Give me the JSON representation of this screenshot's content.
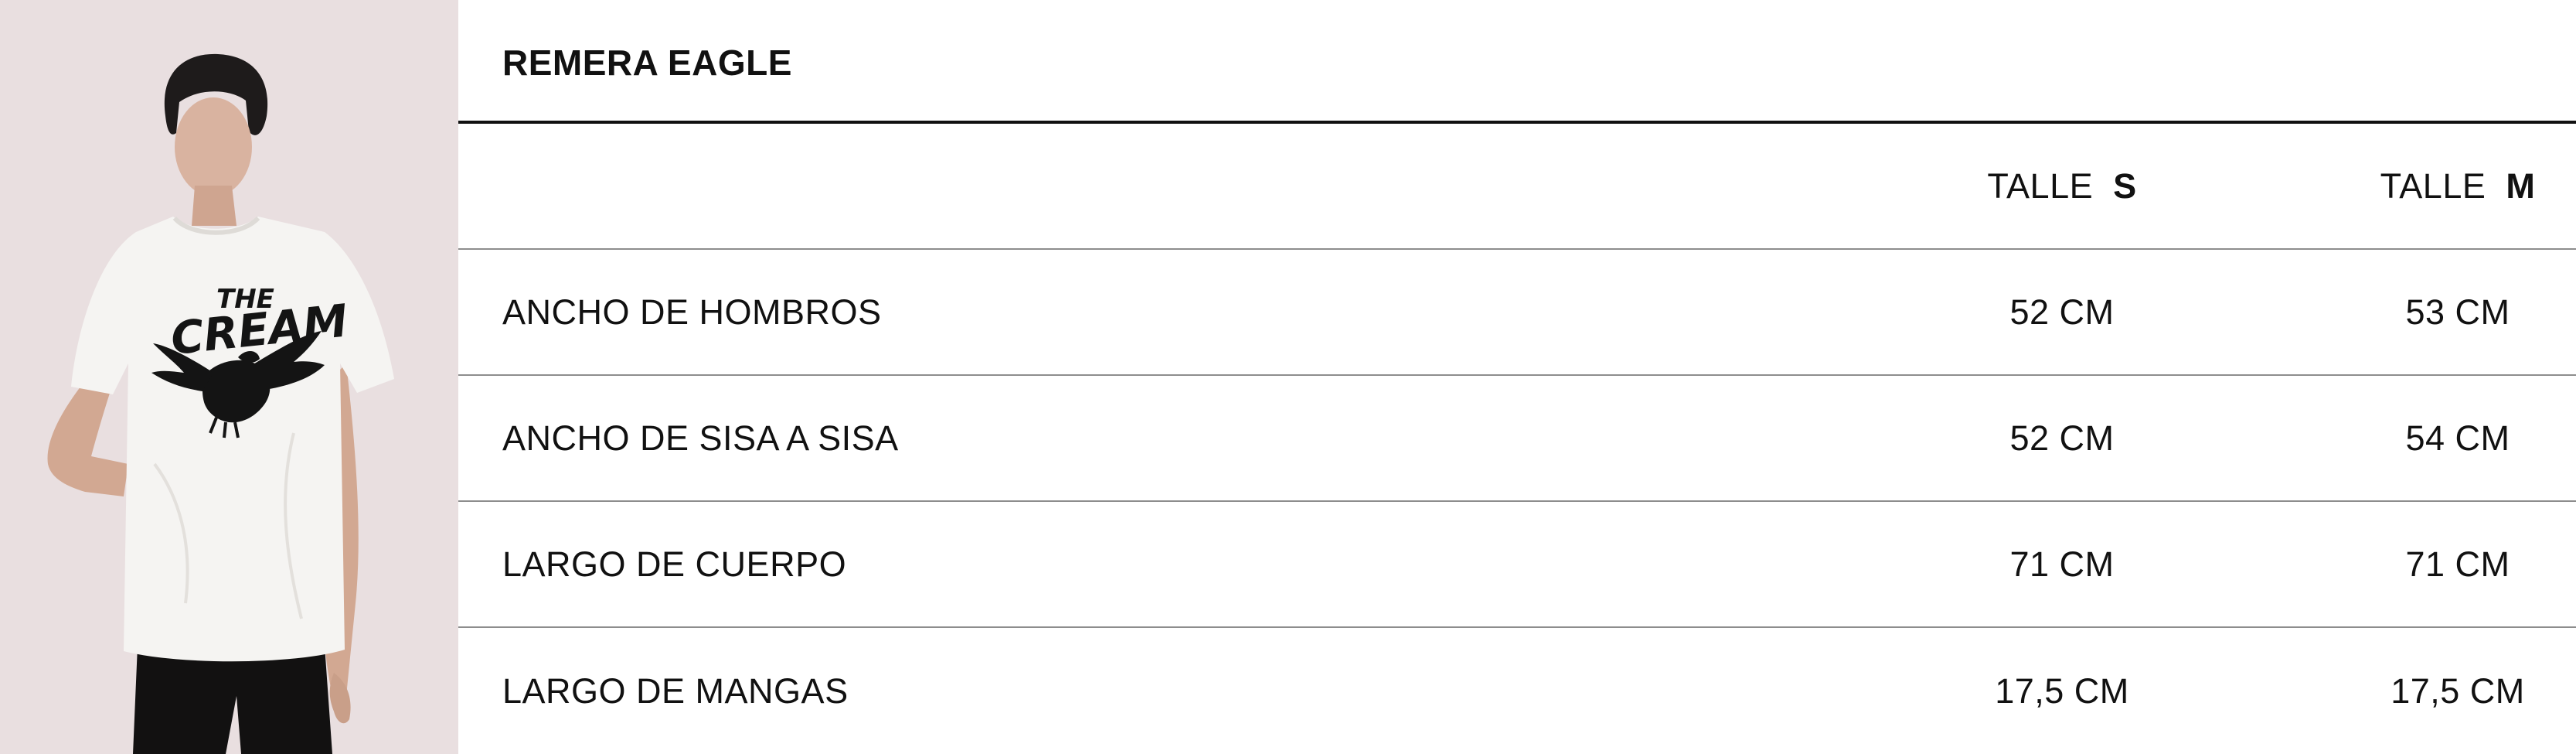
{
  "product": {
    "title": "REMERA EAGLE",
    "image_alt": "Modelo con remera blanca estampada con águila",
    "print_text": [
      "THE",
      "CREAM"
    ]
  },
  "size_table": {
    "columns": [
      {
        "prefix": "TALLE",
        "size": "S"
      },
      {
        "prefix": "TALLE",
        "size": "M"
      }
    ],
    "rows": [
      {
        "label": "ANCHO DE HOMBROS",
        "values": [
          "52 CM",
          "53 CM"
        ]
      },
      {
        "label": "ANCHO DE SISA A SISA",
        "values": [
          "52 CM",
          "54 CM"
        ]
      },
      {
        "label": "LARGO DE CUERPO",
        "values": [
          "71 CM",
          "71 CM"
        ]
      },
      {
        "label": "LARGO DE MANGAS",
        "values": [
          "17,5 CM",
          "17,5 CM"
        ]
      }
    ]
  },
  "colors": {
    "photo_background": "#e9dfe0",
    "text": "#111111",
    "header_rule": "#111111",
    "row_rule": "#8d8d8d"
  }
}
